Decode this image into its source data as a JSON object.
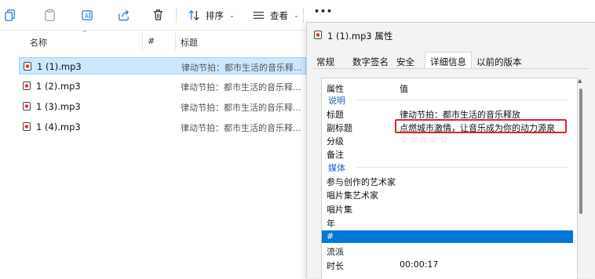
{
  "toolbar": {
    "sort_label": "排序",
    "view_label": "查看",
    "more_label": "•••"
  },
  "columns": {
    "name": "名称",
    "number": "#",
    "title": "标题"
  },
  "files": [
    {
      "name": "1 (1).mp3",
      "title": "律动节拍：都市生活的音乐释...",
      "selected": true
    },
    {
      "name": "1 (2).mp3",
      "title": "律动节拍：都市生活的音乐释...",
      "selected": false
    },
    {
      "name": "1 (3).mp3",
      "title": "律动节拍：都市生活的音乐释...",
      "selected": false
    },
    {
      "name": "1 (4).mp3",
      "title": "律动节拍：都市生活的音乐释...",
      "selected": false
    }
  ],
  "dialog": {
    "title": "1 (1).mp3 属性",
    "tabs": [
      "常规",
      "数字签名",
      "安全",
      "详细信息",
      "以前的版本"
    ],
    "active_tab": "详细信息",
    "header": {
      "property": "属性",
      "value": "值"
    },
    "groups": {
      "description": "说明",
      "media": "媒体"
    },
    "props": {
      "title": {
        "name": "标题",
        "value": "律动节拍：都市生活的音乐释放"
      },
      "subtitle": {
        "name": "副标题",
        "value": "点燃城市激情，让音乐成为你的动力源泉"
      },
      "rating": {
        "name": "分级",
        "stars": 0,
        "max": 5
      },
      "comments": {
        "name": "备注"
      },
      "contributing_artists": {
        "name": "参与创作的艺术家"
      },
      "album_artist": {
        "name": "唱片集艺术家"
      },
      "album": {
        "name": "唱片集"
      },
      "year": {
        "name": "年"
      },
      "track": {
        "name": "#"
      },
      "genre": {
        "name": "流派"
      },
      "length": {
        "name": "时长",
        "value": "00:00:17"
      }
    }
  },
  "colors": {
    "selection": "#cce8ff",
    "highlight": "#0078d7",
    "annotation": "#e0242a",
    "group_text": "#1f5fbf"
  }
}
